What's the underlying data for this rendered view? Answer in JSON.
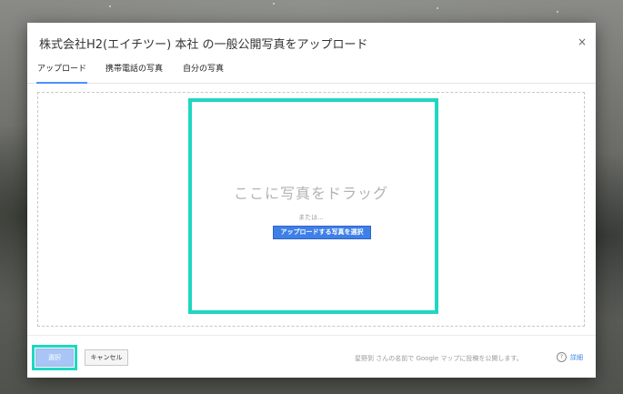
{
  "dialog": {
    "title": "株式会社H2(エイチツー) 本社 の一般公開写真をアップロード",
    "close_symbol": "×"
  },
  "tabs": [
    {
      "label": "アップロード",
      "active": true
    },
    {
      "label": "携帯電話の写真",
      "active": false
    },
    {
      "label": "自分の写真",
      "active": false
    }
  ],
  "dropzone": {
    "drag_text": "ここに写真をドラッグ",
    "or_text": "または...",
    "select_button_label": "アップロードする写真を選択"
  },
  "footer": {
    "select_label": "選択",
    "cancel_label": "キャンセル",
    "notice": "星野到 さんの名前で Google マップに投稿を公開します。",
    "help_symbol": "?",
    "details_label": "詳細"
  },
  "colors": {
    "accent": "#3f7fe8",
    "highlight": "#1fd7c0",
    "tab_underline": "#4d90fe"
  }
}
